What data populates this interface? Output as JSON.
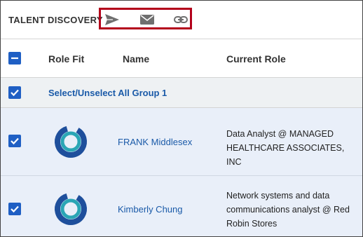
{
  "header": {
    "title": "TALENT DISCOVERY",
    "actions": [
      {
        "icon": "send-icon"
      },
      {
        "icon": "mail-icon"
      },
      {
        "icon": "link-icon"
      }
    ]
  },
  "table": {
    "columns": [
      "Role Fit",
      "Name",
      "Current Role"
    ],
    "group": {
      "label": "Select/Unselect All Group 1",
      "checked": true
    },
    "rows": [
      {
        "name": "FRANK Middlesex",
        "role": "Data Analyst @ MANAGED HEALTHCARE ASSOCIATES, INC",
        "checked": true
      },
      {
        "name": "Kimberly Chung",
        "role": "Network systems and data communications analyst @ Red Robin Stores",
        "checked": true
      }
    ]
  },
  "colors": {
    "accent": "#1f5fc4",
    "link": "#1a5aa8",
    "highlight_border": "#b3001b",
    "donut_outer": "#1e4f9c",
    "donut_inner": "#2aa6b5",
    "row_bg": "#e9eff9"
  }
}
